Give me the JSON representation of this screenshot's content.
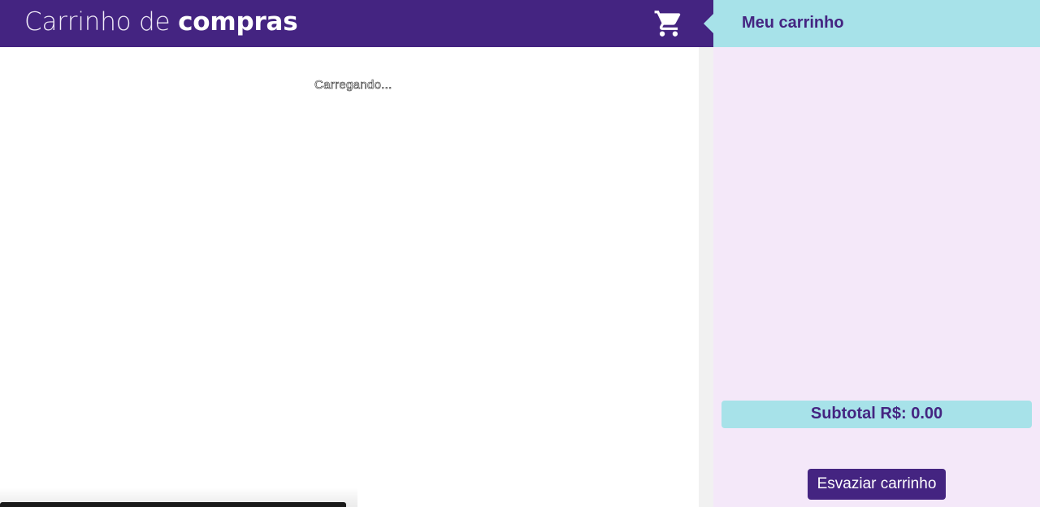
{
  "header": {
    "title_light": "Carrinho de",
    "title_bold": "compras",
    "cart_icon": "shopping-cart-icon",
    "background": "#442481"
  },
  "main": {
    "loading_text": "Carregando..."
  },
  "cart_panel": {
    "title": "Meu carrinho",
    "subtotal_text": "Subtotal R$: 0.00",
    "empty_button_label": "Esvaziar carrinho",
    "header_color": "#a7e2e9",
    "body_color": "#f4e8f9",
    "accent": "#442481"
  }
}
